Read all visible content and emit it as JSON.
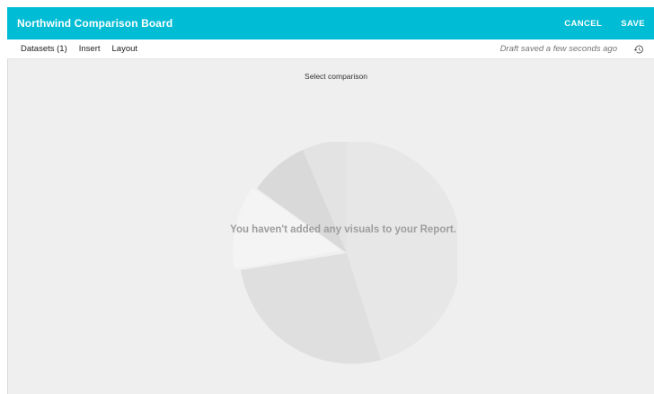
{
  "header": {
    "title": "Northwind Comparison Board",
    "cancel_label": "CANCEL",
    "save_label": "SAVE",
    "accent_color": "#00bcd4"
  },
  "toolbar": {
    "menu": [
      "Datasets (1)",
      "Insert",
      "Layout"
    ],
    "draft_status": "Draft saved a few seconds ago",
    "history_icon": "history-icon"
  },
  "canvas": {
    "select_label": "Select comparison",
    "empty_message": "You haven't added any visuals to your Report.",
    "placeholder_icon": "pie-chart-placeholder-icon"
  }
}
